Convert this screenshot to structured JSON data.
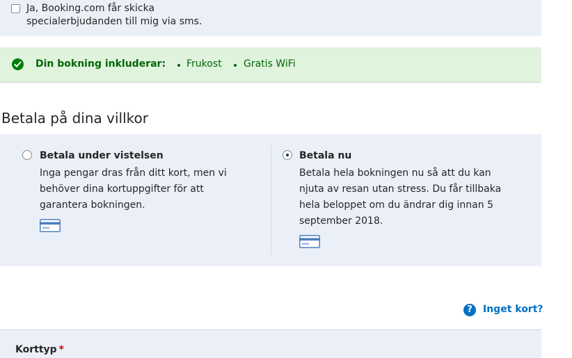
{
  "sms_consent": {
    "checked": false,
    "label_line1": "Ja, Booking.com får skicka",
    "label_line2": "specialerbjudanden till mig via sms."
  },
  "includes": {
    "title": "Din bokning inkluderar:",
    "items": [
      "Frukost",
      "Gratis WiFi"
    ],
    "icon": "check-circle-icon",
    "color": "#008009"
  },
  "payment": {
    "heading": "Betala på dina villkor",
    "options": [
      {
        "title": "Betala under vistelsen",
        "selected": false,
        "desc_lines": [
          "Inga pengar dras från ditt kort, men vi",
          "behöver dina kortuppgifter för att",
          "garantera bokningen."
        ],
        "icon": "credit-card-icon"
      },
      {
        "title": "Betala nu",
        "selected": true,
        "desc_lines": [
          "Betala hela bokningen nu så att du kan",
          "njuta av resan utan stress. Du får tillbaka",
          "hela beloppet om du ändrar dig innan 5",
          "september 2018."
        ],
        "icon": "credit-card-icon"
      }
    ]
  },
  "no_card_link": {
    "label": "Inget kort?",
    "icon": "question-circle-icon",
    "color": "#0071c2"
  },
  "card_form": {
    "card_type_label": "Korttyp",
    "required_mark": "*"
  }
}
